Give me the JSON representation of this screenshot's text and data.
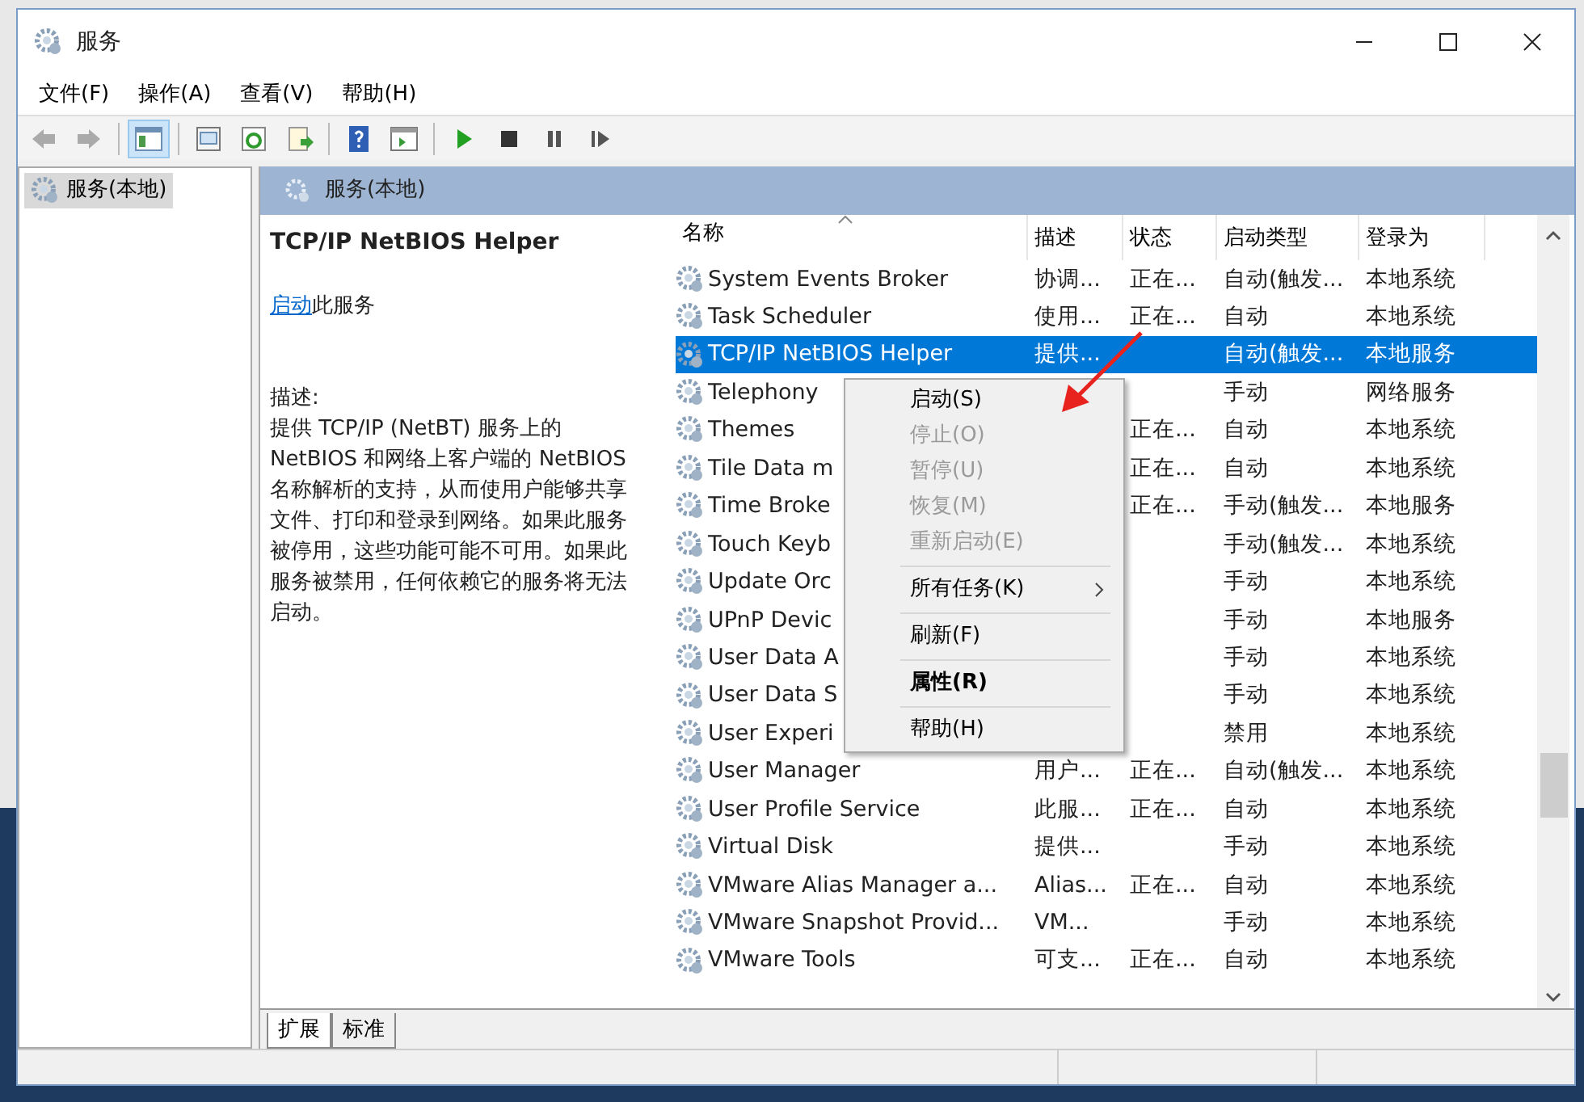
{
  "window": {
    "title": "服务"
  },
  "menu": [
    "文件(F)",
    "操作(A)",
    "查看(V)",
    "帮助(H)"
  ],
  "toolbar": [
    {
      "kind": "back",
      "disabled": true
    },
    {
      "kind": "forward",
      "disabled": true
    },
    {
      "kind": "sep"
    },
    {
      "kind": "tree",
      "selected": true
    },
    {
      "kind": "sep"
    },
    {
      "kind": "props"
    },
    {
      "kind": "refresh"
    },
    {
      "kind": "export"
    },
    {
      "kind": "sep"
    },
    {
      "kind": "help"
    },
    {
      "kind": "console"
    },
    {
      "kind": "sep"
    },
    {
      "kind": "play"
    },
    {
      "kind": "stop"
    },
    {
      "kind": "pause"
    },
    {
      "kind": "resume"
    }
  ],
  "tree": [
    {
      "label": "服务(本地)",
      "selected": true
    }
  ],
  "panel": {
    "title": "服务(本地)"
  },
  "details": {
    "service": "TCP/IP NetBIOS Helper",
    "action_link": "启动",
    "action_suffix": "此服务",
    "description_label": "描述:",
    "description": "提供 TCP/IP (NetBT) 服务上的 NetBIOS 和网络上客户端的 NetBIOS 名称解析的支持，从而使用户能够共享文件、打印和登录到网络。如果此服务被停用，这些功能可能不可用。如果此服务被禁用，任何依赖它的服务将无法启动。"
  },
  "table": {
    "columns": [
      {
        "label": "名称",
        "sorted": true
      },
      {
        "label": "描述",
        "sorted": false
      },
      {
        "label": "状态",
        "sorted": false
      },
      {
        "label": "启动类型",
        "sorted": false
      },
      {
        "label": "登录为",
        "sorted": false
      }
    ],
    "rows": [
      {
        "name": "System Events Broker",
        "description": "协调...",
        "status": "正在...",
        "startup": "自动(触发...",
        "logon": "本地系统",
        "selected": false
      },
      {
        "name": "Task Scheduler",
        "description": "使用...",
        "status": "正在...",
        "startup": "自动",
        "logon": "本地系统",
        "selected": false
      },
      {
        "name": "TCP/IP NetBIOS Helper",
        "description": "提供...",
        "startup": "自动(触发...",
        "logon": "本地服务",
        "selected": true
      },
      {
        "name": "Telephony",
        "startup": "手动",
        "logon": "网络服务",
        "selected": false
      },
      {
        "name": "Themes",
        "status": "正在...",
        "startup": "自动",
        "logon": "本地系统",
        "selected": false
      },
      {
        "name": "Tile Data m",
        "status": "正在...",
        "startup": "自动",
        "logon": "本地系统",
        "selected": false
      },
      {
        "name": "Time Broke",
        "status": "正在...",
        "startup": "手动(触发...",
        "logon": "本地服务",
        "selected": false
      },
      {
        "name": "Touch Keyb",
        "startup": "手动(触发...",
        "logon": "本地系统",
        "selected": false
      },
      {
        "name": "Update Orc",
        "startup": "手动",
        "logon": "本地系统",
        "selected": false
      },
      {
        "name": "UPnP Devic",
        "startup": "手动",
        "logon": "本地服务",
        "selected": false
      },
      {
        "name": "User Data A",
        "startup": "手动",
        "logon": "本地系统",
        "selected": false
      },
      {
        "name": "User Data S",
        "startup": "手动",
        "logon": "本地系统",
        "selected": false
      },
      {
        "name": "User Experi",
        "startup": "禁用",
        "logon": "本地系统",
        "selected": false
      },
      {
        "name": "User Manager",
        "description": "用户...",
        "status": "正在...",
        "startup": "自动(触发...",
        "logon": "本地系统",
        "selected": false
      },
      {
        "name": "User Profile Service",
        "description": "此服...",
        "status": "正在...",
        "startup": "自动",
        "logon": "本地系统",
        "selected": false
      },
      {
        "name": "Virtual Disk",
        "description": "提供...",
        "startup": "手动",
        "logon": "本地系统",
        "selected": false
      },
      {
        "name": "VMware Alias Manager a...",
        "description": "Alias...",
        "status": "正在...",
        "startup": "自动",
        "logon": "本地系统",
        "selected": false
      },
      {
        "name": "VMware Snapshot Provid...",
        "description": "VM...",
        "startup": "手动",
        "logon": "本地系统",
        "selected": false
      },
      {
        "name": "VMware Tools",
        "description": "可支...",
        "status": "正在...",
        "startup": "自动",
        "logon": "本地系统",
        "selected": false
      }
    ]
  },
  "context_menu": [
    {
      "kind": "item",
      "label": "启动(S)",
      "disabled": false
    },
    {
      "kind": "item",
      "label": "停止(O)",
      "disabled": true
    },
    {
      "kind": "item",
      "label": "暂停(U)",
      "disabled": true
    },
    {
      "kind": "item",
      "label": "恢复(M)",
      "disabled": true
    },
    {
      "kind": "item",
      "label": "重新启动(E)",
      "disabled": true
    },
    {
      "kind": "separator"
    },
    {
      "kind": "item",
      "label": "所有任务(K)",
      "disabled": false,
      "submenu": true
    },
    {
      "kind": "separator"
    },
    {
      "kind": "item",
      "label": "刷新(F)",
      "disabled": false
    },
    {
      "kind": "separator"
    },
    {
      "kind": "item",
      "label": "属性(R)",
      "disabled": false,
      "bold": true
    },
    {
      "kind": "separator"
    },
    {
      "kind": "item",
      "label": "帮助(H)",
      "disabled": false
    }
  ],
  "tabs": [
    {
      "label": "扩展",
      "selected": true
    },
    {
      "label": "标准",
      "selected": false
    }
  ]
}
